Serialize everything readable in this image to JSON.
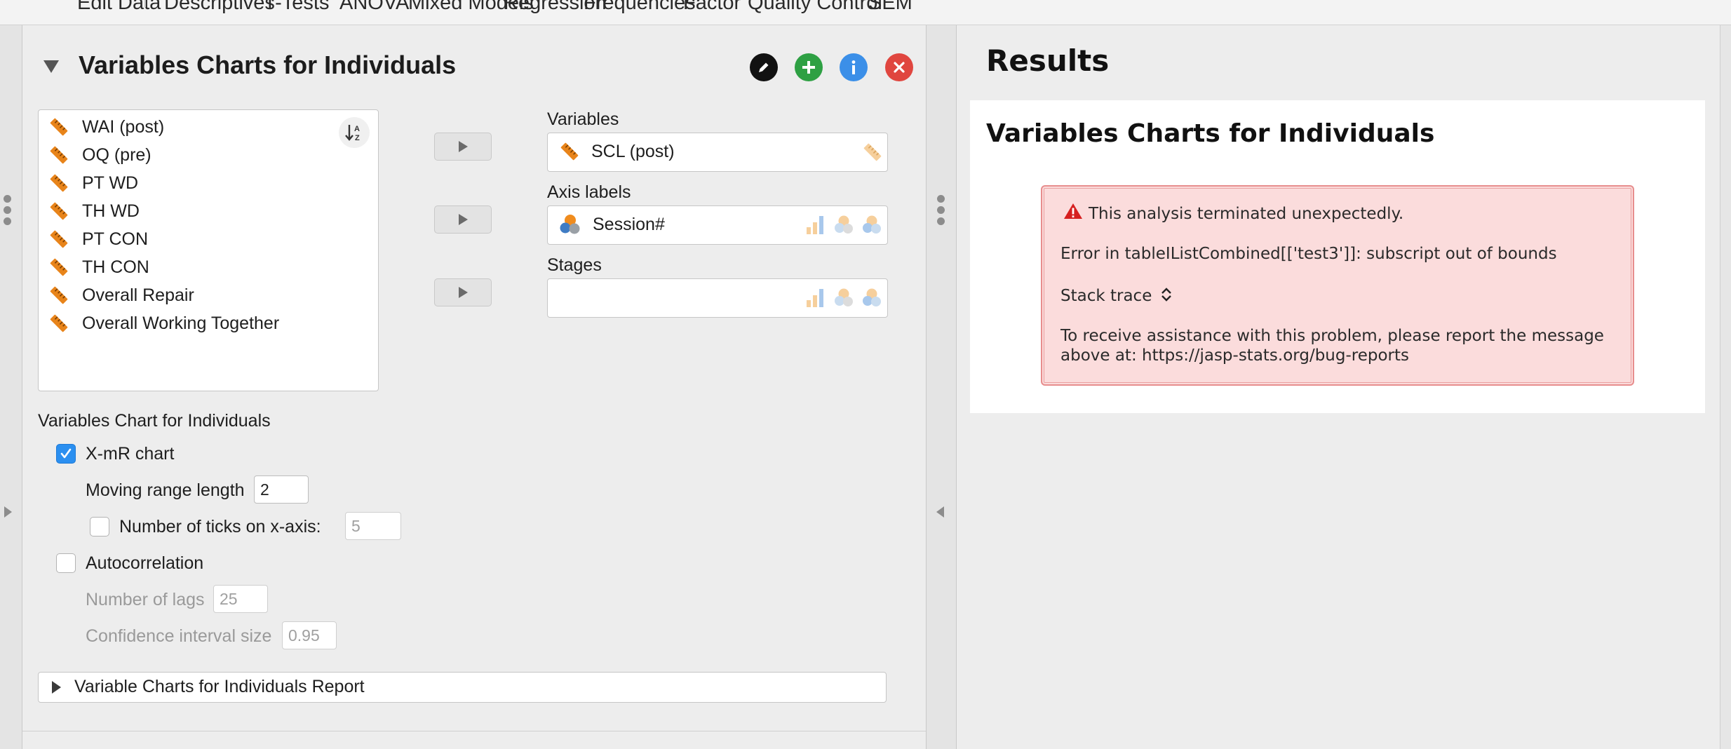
{
  "menu": {
    "items": [
      "Edit Data",
      "Descriptives",
      "T-Tests",
      "ANOVA",
      "Mixed Models",
      "Regression",
      "Frequencies",
      "Factor",
      "Quality Control",
      "SEM"
    ]
  },
  "analysis": {
    "title": "Variables Charts for Individuals",
    "header_buttons": [
      {
        "name": "edit",
        "icon": "pencil-icon",
        "color": "#111111"
      },
      {
        "name": "duplicate",
        "icon": "plus-icon",
        "color": "#2ea043"
      },
      {
        "name": "info",
        "icon": "info-icon",
        "color": "#3b8fe8"
      },
      {
        "name": "close",
        "icon": "close-icon",
        "color": "#e0463f"
      }
    ]
  },
  "available_variables": [
    {
      "label": "WAI (post)",
      "type": "scale"
    },
    {
      "label": "OQ (pre)",
      "type": "scale"
    },
    {
      "label": "PT WD",
      "type": "scale"
    },
    {
      "label": "TH WD",
      "type": "scale"
    },
    {
      "label": "PT CON",
      "type": "scale"
    },
    {
      "label": "TH CON",
      "type": "scale"
    },
    {
      "label": "Overall Repair",
      "type": "scale"
    },
    {
      "label": "Overall Working Together",
      "type": "scale"
    }
  ],
  "assign": {
    "variables": {
      "label": "Variables",
      "value": "SCL (post)",
      "value_type": "scale"
    },
    "axis_labels": {
      "label": "Axis labels",
      "value": "Session#",
      "value_type": "nominal"
    },
    "stages": {
      "label": "Stages",
      "value": ""
    }
  },
  "options": {
    "section_label": "Variables Chart for Individuals",
    "xmr_chart": {
      "label": "X-mR chart",
      "checked": true
    },
    "moving_range_length": {
      "label": "Moving range length",
      "value": "2"
    },
    "num_ticks": {
      "label": "Number of ticks on x-axis:",
      "checked": false,
      "value": "5"
    },
    "autocorrelation": {
      "label": "Autocorrelation",
      "checked": false
    },
    "num_lags": {
      "label": "Number of lags",
      "value": "25"
    },
    "ci_size": {
      "label": "Confidence interval size",
      "value": "0.95"
    },
    "report": {
      "label": "Variable Charts for Individuals Report"
    }
  },
  "results": {
    "heading": "Results",
    "analysis_title": "Variables Charts for Individuals",
    "error": {
      "title": "This analysis terminated unexpectedly.",
      "message": "Error in tableIListCombined[['test3']]: subscript out of bounds",
      "stack_trace": "Stack trace",
      "assist_line1": "To receive assistance with this problem, please report the message",
      "assist_line2": "above at: https://jasp-stats.org/bug-reports"
    }
  },
  "colors": {
    "accent": "#2b8ff0",
    "error_bg": "#fbdcdc",
    "error_border": "#e78e8e",
    "scale_icon": "#e8841a"
  }
}
